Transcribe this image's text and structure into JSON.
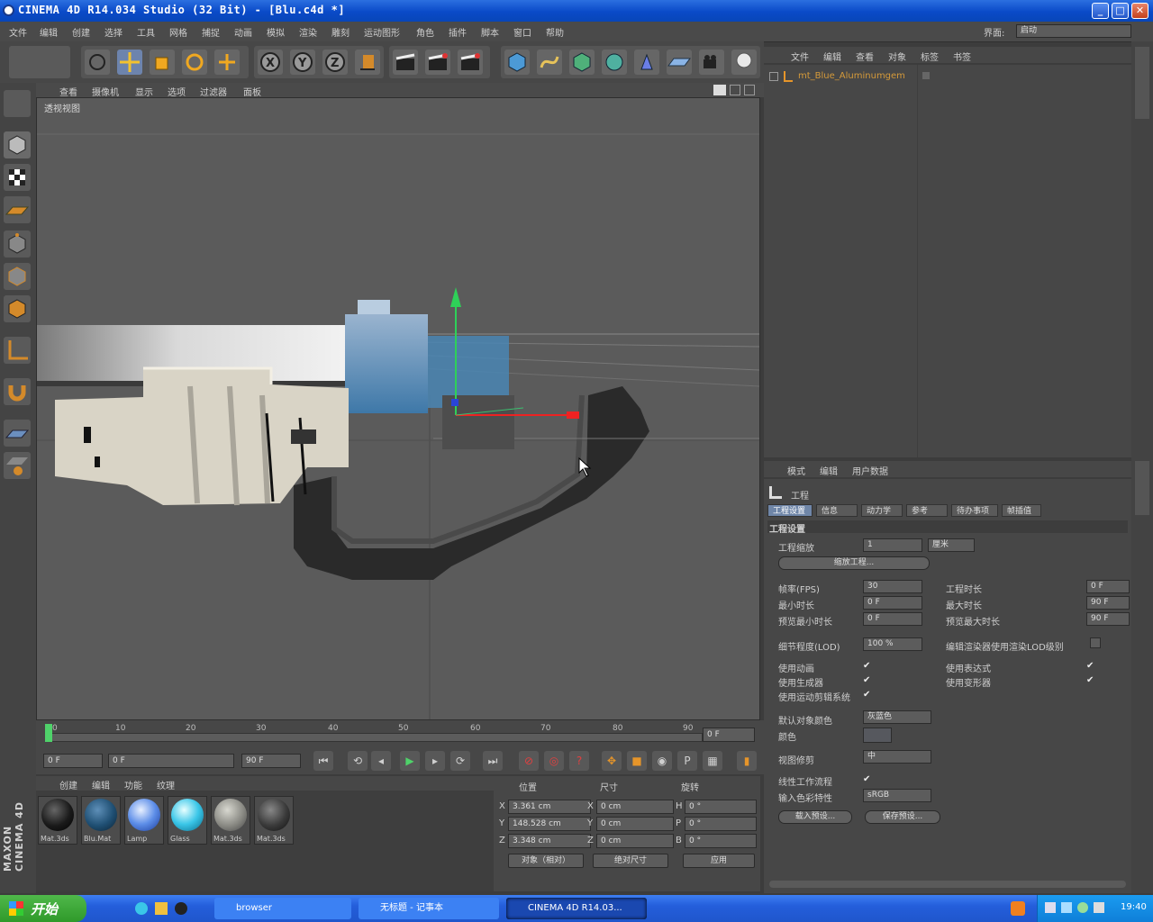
{
  "window": {
    "title": "CINEMA 4D R14.034 Studio (32 Bit) - [Blu.c4d *]",
    "btn_min": "_",
    "btn_max": "□",
    "btn_close": "✕"
  },
  "menubar": {
    "items": [
      "文件",
      "编辑",
      "创建",
      "选择",
      "工具",
      "网格",
      "捕捉",
      "动画",
      "模拟",
      "渲染",
      "雕刻",
      "运动图形",
      "角色",
      "插件",
      "脚本",
      "窗口",
      "帮助"
    ],
    "layout_label": "界面:",
    "layout_value": "启动"
  },
  "viewport": {
    "menus": [
      "查看",
      "摄像机",
      "显示",
      "选项",
      "过滤器",
      "面板"
    ],
    "label": "透视视图"
  },
  "timeline": {
    "ticks": [
      "0",
      "10",
      "20",
      "30",
      "40",
      "50",
      "60",
      "70",
      "80",
      "90"
    ],
    "current_frame": "0 F"
  },
  "transport": {
    "start_field": "0 F",
    "end_field": "90 F",
    "range_value": "0 F"
  },
  "materials": {
    "menus": [
      "创建",
      "编辑",
      "功能",
      "纹理"
    ],
    "items": [
      {
        "label": "Mat.3ds",
        "color": "#1a1a1a"
      },
      {
        "label": "Blu.Mat",
        "color": "#1f4f73"
      },
      {
        "label": "Lamp",
        "color": "#5d8ee8"
      },
      {
        "label": "Glass",
        "color": "#3ac6e8"
      },
      {
        "label": "Mat.3ds",
        "color": "#8a8a84"
      },
      {
        "label": "Mat.3ds",
        "color": "#3a3a3a"
      }
    ]
  },
  "coords": {
    "headers": [
      "位置",
      "尺寸",
      "旋转"
    ],
    "rows": [
      {
        "axis": "X",
        "pos": "3.361 cm",
        "size_axis": "X",
        "size": "0 cm",
        "rot_axis": "H",
        "rot": "0 °"
      },
      {
        "axis": "Y",
        "pos": "148.528 cm",
        "size_axis": "Y",
        "size": "0 cm",
        "rot_axis": "P",
        "rot": "0 °"
      },
      {
        "axis": "Z",
        "pos": "3.348 cm",
        "size_axis": "Z",
        "size": "0 cm",
        "rot_axis": "B",
        "rot": "0 °"
      }
    ],
    "mode_btn": "对象（相对）",
    "size_btn": "绝对尺寸",
    "apply_btn": "应用"
  },
  "object_manager": {
    "tabs": [
      "文件",
      "编辑",
      "查看",
      "对象",
      "标签",
      "书签"
    ],
    "object_name": "mt_Blue_Aluminumgem"
  },
  "attributes": {
    "tabs": [
      "模式",
      "编辑",
      "用户数据"
    ],
    "header": "工程",
    "subtabs": [
      "工程设置",
      "信息",
      "动力学",
      "参考",
      "待办事项",
      "帧插值"
    ],
    "section": "工程设置",
    "scale_label": "工程缩放",
    "scale_value": "1",
    "scale_unit": "厘米",
    "scale_btn": "缩放工程...",
    "fps_label": "帧率(FPS)",
    "fps_value": "30",
    "project_time_label": "工程时长",
    "project_time_value": "0 F",
    "min_time_label": "最小时长",
    "min_time_value": "0 F",
    "max_time_label": "最大时长",
    "max_time_value": "90 F",
    "preview_min_label": "预览最小时长",
    "preview_min_value": "0 F",
    "preview_max_label": "预览最大时长",
    "preview_max_value": "90 F",
    "lod_label": "细节程度(LOD)",
    "lod_value": "100 %",
    "lod_render_label": "编辑渲染器使用渲染LOD级别",
    "use_anim_label": "使用动画",
    "use_expr_label": "使用表达式",
    "use_gen_label": "使用生成器",
    "use_deform_label": "使用变形器",
    "use_motion_label": "使用运动剪辑系统",
    "check": "✔",
    "default_obj_color_label": "默认对象颜色",
    "default_obj_color_value": "灰蓝色",
    "color_label": "颜色",
    "view_clip_label": "视图修剪",
    "view_clip_value": "中",
    "linear_workflow_label": "线性工作流程",
    "input_color_label": "输入色彩特性",
    "input_color_value": "sRGB",
    "load_preset_btn": "载入预设...",
    "save_preset_btn": "保存预设..."
  },
  "taskbar": {
    "start": "开始",
    "tasks": [
      "browser",
      "无标题 - 记事本",
      "CINEMA 4D R14.03..."
    ],
    "clock": "19:40"
  },
  "brand": "MAXON CINEMA 4D",
  "colors": {
    "accent_orange": "#d59a3a",
    "selection_blue": "#6f86a8"
  }
}
